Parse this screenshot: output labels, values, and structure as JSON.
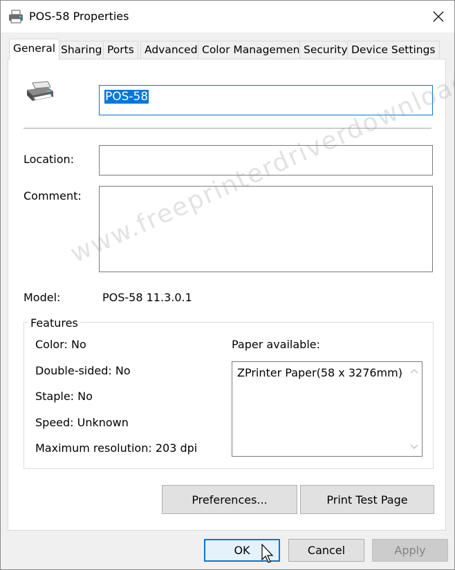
{
  "window": {
    "title": "POS-58 Properties"
  },
  "tabs": [
    {
      "label": "General",
      "active": true
    },
    {
      "label": "Sharing",
      "active": false
    },
    {
      "label": "Ports",
      "active": false
    },
    {
      "label": "Advanced",
      "active": false
    },
    {
      "label": "Color Management",
      "active": false
    },
    {
      "label": "Security",
      "active": false
    },
    {
      "label": "Device Settings",
      "active": false
    }
  ],
  "general": {
    "printer_name": "POS-58",
    "location_label": "Location:",
    "location_value": "",
    "comment_label": "Comment:",
    "comment_value": "",
    "model_label": "Model:",
    "model_value": "POS-58 11.3.0.1"
  },
  "features": {
    "legend": "Features",
    "color": "Color: No",
    "double_sided": "Double-sided: No",
    "staple": "Staple: No",
    "speed": "Speed: Unknown",
    "max_resolution": "Maximum resolution: 203 dpi",
    "paper_label": "Paper available:",
    "paper_items": [
      "ZPrinter Paper(58 x 3276mm)"
    ]
  },
  "buttons": {
    "preferences": "Preferences...",
    "print_test": "Print Test Page",
    "ok": "OK",
    "cancel": "Cancel",
    "apply": "Apply"
  },
  "watermark": "www.freeprinterdriverdownload.org",
  "colors": {
    "accent": "#0078d7",
    "selection_text": "#ffffff"
  }
}
